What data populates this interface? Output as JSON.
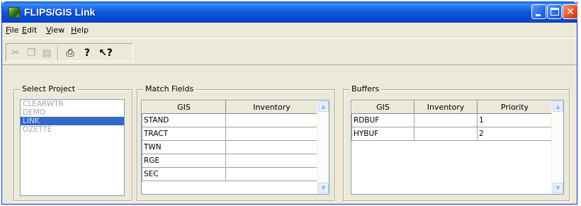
{
  "window": {
    "title": "FLIPS/GIS Link"
  },
  "menu": {
    "file": {
      "acc": "F",
      "rest": "ile"
    },
    "edit": {
      "acc": "E",
      "rest": "dit"
    },
    "view": {
      "acc": "V",
      "rest": "iew"
    },
    "help": {
      "acc": "H",
      "rest": "elp"
    }
  },
  "toolbar": {
    "cut_icon": "✂",
    "copy_icon": "❐",
    "paste_icon": "▤",
    "print_icon": "⎙",
    "help_icon": "?",
    "context_help_icon": "↖?"
  },
  "select_project": {
    "label": "Select Project",
    "items": [
      "CLEARWTR",
      "DEMO",
      "LINK",
      "OZETTE"
    ],
    "selected": "LINK"
  },
  "match_fields": {
    "label": "Match Fields",
    "columns": [
      "GIS",
      "Inventory"
    ],
    "rows": [
      [
        "STAND",
        ""
      ],
      [
        "TRACT",
        ""
      ],
      [
        "TWN",
        ""
      ],
      [
        "RGE",
        ""
      ],
      [
        "SEC",
        ""
      ]
    ]
  },
  "buffers": {
    "label": "Buffers",
    "columns": [
      "GIS",
      "Inventory",
      "Priority"
    ],
    "rows": [
      [
        "RDBUF",
        "",
        "1"
      ],
      [
        "HYBUF",
        "",
        "2"
      ]
    ]
  },
  "colors": {
    "titlebar": "#0a58e0",
    "selection": "#316ac5",
    "window_bg": "#ece9d8"
  }
}
